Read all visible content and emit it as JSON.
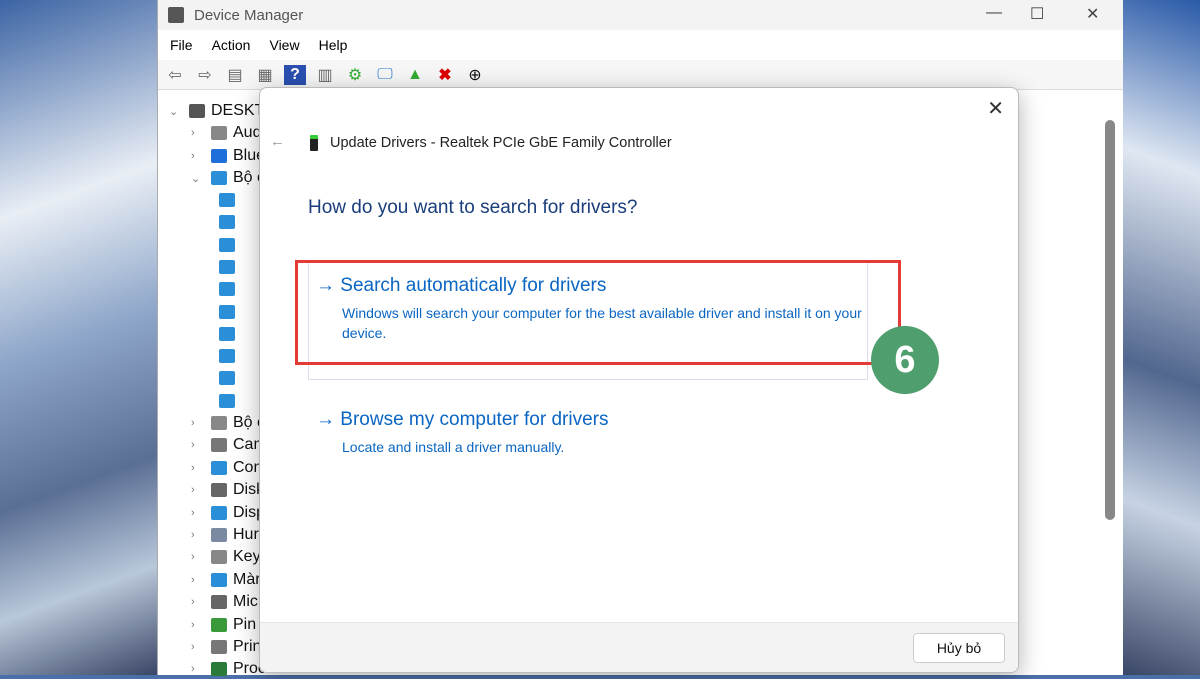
{
  "window": {
    "title": "Device Manager",
    "minimize": "—",
    "maximize": "☐",
    "close": "✕"
  },
  "menu": [
    "File",
    "Action",
    "View",
    "Help"
  ],
  "tree": {
    "root": "DESKTO",
    "categories_top": [
      "Aud",
      "Blue",
      "Bộ c"
    ],
    "categories_bottom": [
      "Bộ c",
      "Cam",
      "Con",
      "Disk",
      "Disp",
      "Hur",
      "Key",
      "Màr",
      "Mic",
      "Pin",
      "Prin",
      "Proc"
    ]
  },
  "dialog": {
    "close": "✕",
    "back": "←",
    "title": "Update Drivers - Realtek PCIe GbE Family Controller",
    "question": "How do you want to search for drivers?",
    "options": [
      {
        "arrow": "→",
        "title": "Search automatically for drivers",
        "desc": "Windows will search your computer for the best available driver and install it on your device."
      },
      {
        "arrow": "→",
        "title": "Browse my computer for drivers",
        "desc": "Locate and install a driver manually."
      }
    ],
    "cancel": "Hủy bỏ"
  },
  "annotation": {
    "step": "6",
    "color": "#e53935"
  }
}
